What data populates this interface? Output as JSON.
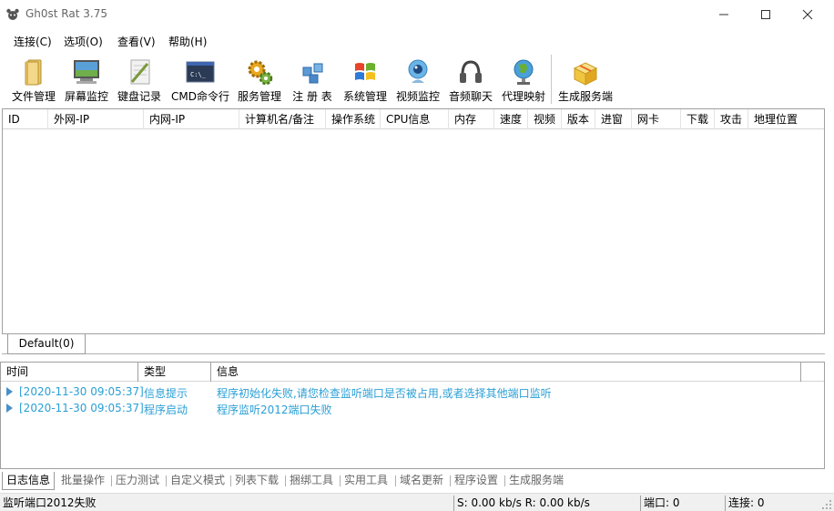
{
  "window": {
    "title": "Gh0st Rat 3.75"
  },
  "menu": [
    "连接(C)",
    "选项(O)",
    "查看(V)",
    "帮助(H)"
  ],
  "toolbar": [
    {
      "label": "文件管理",
      "icon": "folder-icon"
    },
    {
      "label": "屏幕监控",
      "icon": "monitor-icon"
    },
    {
      "label": "键盘记录",
      "icon": "notepad-icon"
    },
    {
      "label": "CMD命令行",
      "icon": "terminal-icon"
    },
    {
      "label": "服务管理",
      "icon": "gears-icon"
    },
    {
      "label": "注 册 表",
      "icon": "registry-icon"
    },
    {
      "label": "系统管理",
      "icon": "windows-icon"
    },
    {
      "label": "视频监控",
      "icon": "webcam-icon"
    },
    {
      "label": "音频聊天",
      "icon": "headphones-icon"
    },
    {
      "label": "代理映射",
      "icon": "globe-icon"
    },
    {
      "label": "生成服务端",
      "icon": "package-icon"
    }
  ],
  "host_columns": [
    "ID",
    "外网-IP",
    "内网-IP",
    "计算机名/备注",
    "操作系统",
    "CPU信息",
    "内存",
    "速度",
    "视频",
    "版本",
    "进窗",
    "网卡",
    "下载",
    "攻击",
    "地理位置"
  ],
  "host_tab": "Default(0)",
  "log_columns": [
    "时间",
    "类型",
    "信息"
  ],
  "log_rows": [
    {
      "time": "[2020-11-30 09:05:37]",
      "type": "信息提示",
      "message": "程序初始化失败,请您检查监听端口是否被占用,或者选择其他端口监听"
    },
    {
      "time": "[2020-11-30 09:05:37]",
      "type": "程序启动",
      "message": "程序监听2012端口失败"
    }
  ],
  "bottom_tabs": [
    "日志信息",
    "批量操作",
    "压力测试",
    "自定义模式",
    "列表下载",
    "捆绑工具",
    "实用工具",
    "域名更新",
    "程序设置",
    "生成服务端"
  ],
  "status": {
    "message": "监听端口2012失败",
    "speed": "S: 0.00 kb/s R: 0.00 kb/s",
    "port": "端口: 0",
    "connections": "连接: 0"
  },
  "colors": {
    "log_text": "#2a9fd6",
    "arrow": "#4a90c8"
  }
}
